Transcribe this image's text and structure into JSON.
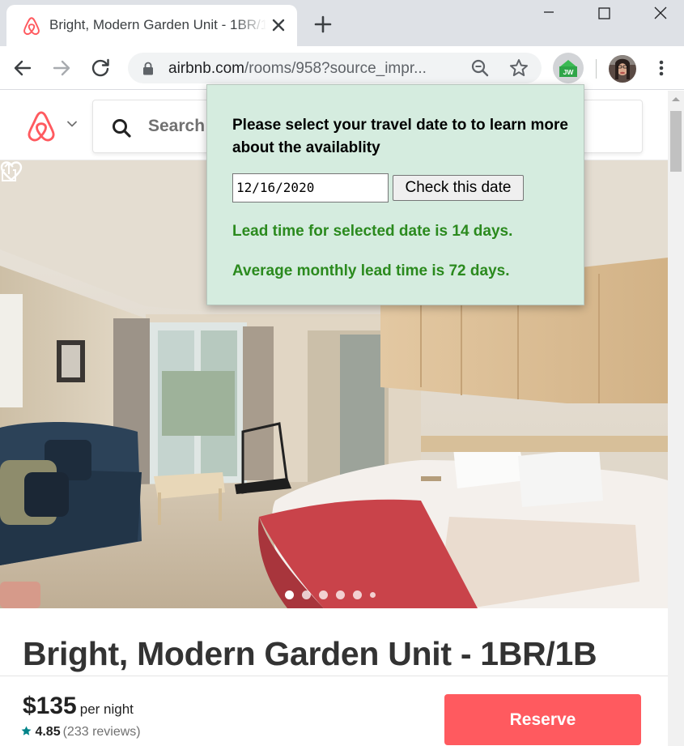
{
  "browser": {
    "tab": {
      "title": "Bright, Modern Garden Unit - 1BR/1B"
    },
    "address": {
      "domain": "airbnb.com",
      "path": "/rooms/958?source_impr..."
    }
  },
  "site": {
    "search_label": "Search",
    "listing_title": "Bright, Modern Garden Unit - 1BR/1B",
    "photo_carousel": {
      "total": 6,
      "active": 1
    },
    "booking": {
      "price": "$135",
      "per_night": "per night",
      "rating": "4.85",
      "reviews": "(233 reviews)",
      "reserve_label": "Reserve"
    }
  },
  "extension": {
    "badge": "JW",
    "heading": "Please select your travel date to to learn more about the availablity",
    "date_value": "12/16/2020",
    "check_button": "Check this date",
    "lead_time": "Lead time for selected date is 14 days.",
    "average_lead_time": "Average monthly lead time is 72 days."
  },
  "colors": {
    "brand": "#ff5a5f",
    "popup_background": "#d5ecdf",
    "lead_text": "#2b8a1e",
    "rating_star": "#008489",
    "extension_icon": "#3cba54"
  },
  "icons": {
    "favicon": "airbnb-logo-icon",
    "tab_close": "close-icon",
    "new_tab": "plus-icon",
    "back": "arrow-left-icon",
    "forward": "arrow-right-icon",
    "reload": "reload-icon",
    "lock": "lock-icon",
    "zoom": "zoom-out-icon",
    "bookmark": "star-icon",
    "menu": "kebab-menu-icon",
    "save": "heart-icon",
    "share": "share-icon",
    "search": "search-icon"
  }
}
